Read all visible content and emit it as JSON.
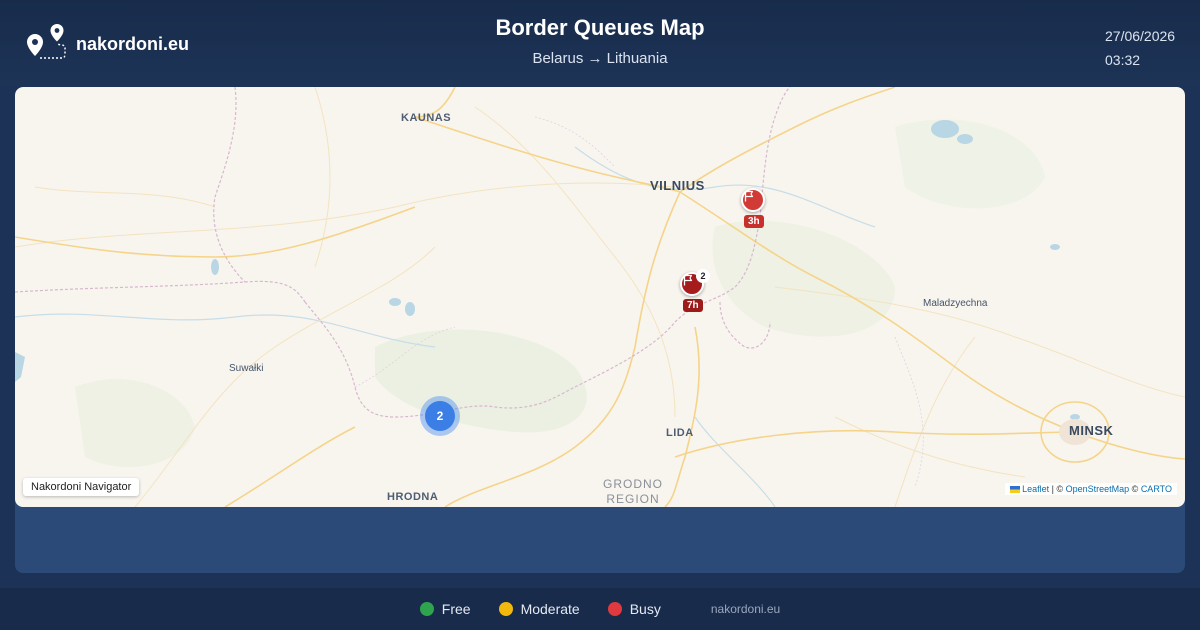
{
  "header": {
    "brand": "nakordoni.eu",
    "title": "Border Queues Map",
    "subtitle": "Belarus → Lithuania",
    "date": "27/06/2026",
    "time": "03:32"
  },
  "map": {
    "places": {
      "kaunas": "KAUNAS",
      "vilnius": "VILNIUS",
      "maladzyechna": "Maladzyechna",
      "suwalki": "Suwałki",
      "lida": "LIDA",
      "minsk": "MINSK",
      "hrodna": "HRODNA",
      "grodno_region_1": "GRODNO",
      "grodno_region_2": "REGION"
    },
    "markers": [
      {
        "status": "busy",
        "wait": "3h",
        "icon": "flag-icon"
      },
      {
        "status": "busy",
        "wait": "7h",
        "icon": "flag-icon",
        "count": "2"
      }
    ],
    "cluster": {
      "count": "2"
    },
    "control_label": "Nakordoni Navigator",
    "attribution": {
      "leaflet": "Leaflet",
      "sep1": " | © ",
      "osm": "OpenStreetMap",
      "sep2": " © ",
      "carto": "CARTO"
    }
  },
  "legend": [
    {
      "label": "Free",
      "color": "#2ea44f"
    },
    {
      "label": "Moderate",
      "color": "#f0b90b"
    },
    {
      "label": "Busy",
      "color": "#e03a3e"
    }
  ],
  "footer": {
    "site": "nakordoni.eu"
  }
}
